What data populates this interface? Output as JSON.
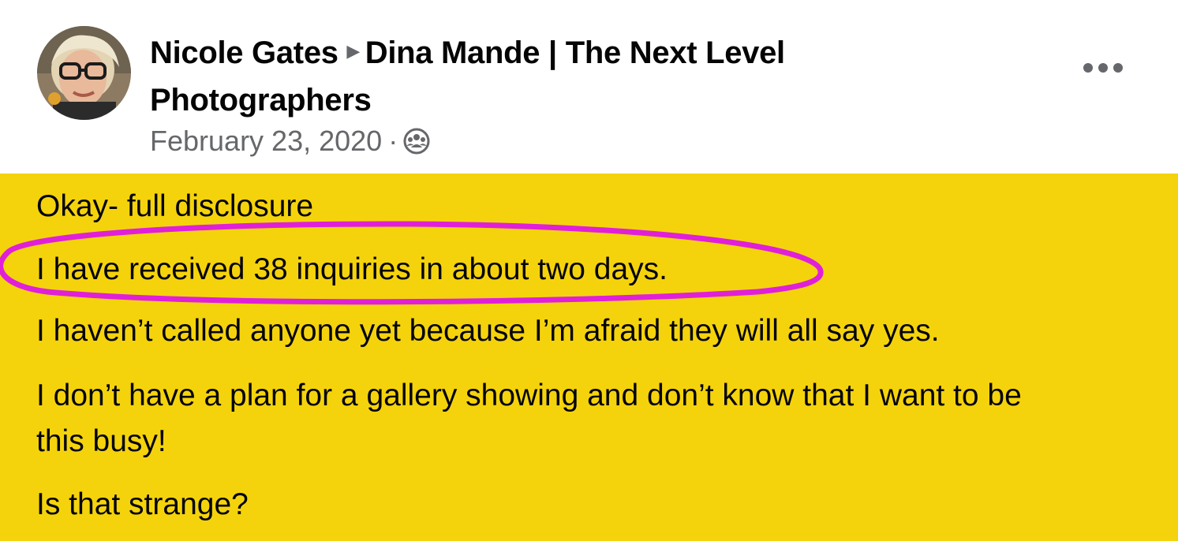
{
  "post": {
    "author": "Nicole Gates",
    "group_line1": "Dina Mande | The Next Level",
    "group_line2": "Photographers",
    "date": "February 23, 2020",
    "separator": "·",
    "privacy_icon": "members-group-icon",
    "more_icon": "more-horizontal-icon",
    "body_lines": [
      "Okay- full disclosure",
      "I have received 38 inquiries in about two days.",
      "I haven’t called anyone yet because I’m afraid they will all say yes.",
      "I don’t have a plan for a gallery showing and don’t know that I want to be",
      "this busy!",
      "Is that strange?"
    ]
  },
  "colors": {
    "background_highlight": "#f5d30c",
    "annotation_oval": "#e020d8",
    "text_primary": "#050505",
    "text_secondary": "#65676b"
  }
}
